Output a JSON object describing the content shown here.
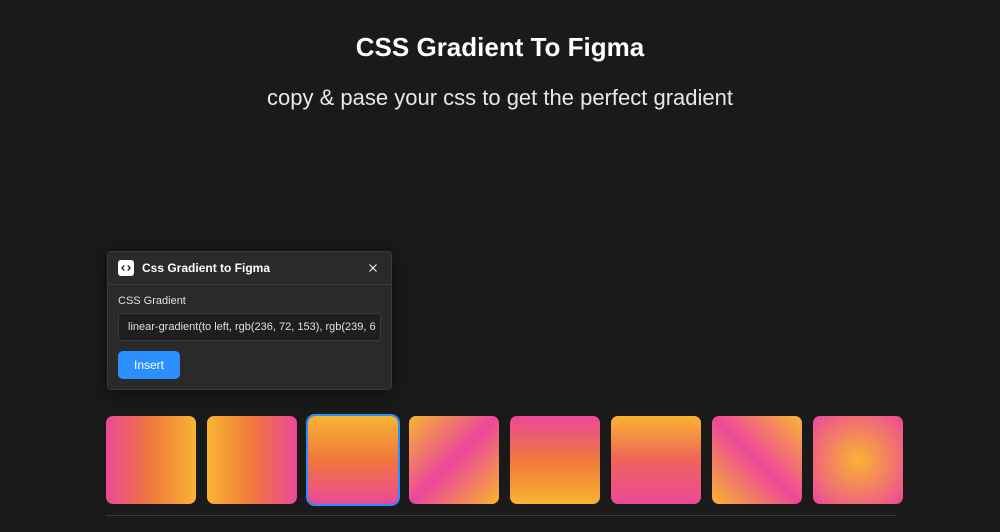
{
  "header": {
    "title": "CSS Gradient To Figma",
    "subtitle": "copy & pase your css to get the perfect gradient"
  },
  "panel": {
    "title": "Css Gradient to Figma",
    "input_label": "CSS Gradient",
    "input_value": "linear-gradient(to left, rgb(236, 72, 153), rgb(239, 6",
    "insert_label": "Insert"
  },
  "swatches": {
    "selected_index": 2,
    "items": [
      {
        "gradient_class": "g0"
      },
      {
        "gradient_class": "g1"
      },
      {
        "gradient_class": "g2"
      },
      {
        "gradient_class": "g3"
      },
      {
        "gradient_class": "g4"
      },
      {
        "gradient_class": "g5"
      },
      {
        "gradient_class": "g6"
      },
      {
        "gradient_class": "g7"
      }
    ]
  },
  "colors": {
    "accent": "#2c8fff",
    "panel_bg": "#2a2a2a",
    "page_bg": "#1a1a1a"
  }
}
